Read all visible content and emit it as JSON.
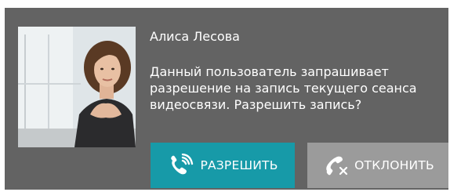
{
  "caller": {
    "name": "Алиса Лесова",
    "photo": "woman-portrait"
  },
  "message": {
    "line1": "Данный пользователь запрашивает",
    "line2": "разрешение на запись текущего сеанса",
    "line3": "видеосвязи. Разрешить запись?"
  },
  "actions": {
    "allow_label": "РАЗРЕШИТЬ",
    "allow_icon": "phone-ringing-icon",
    "allow_color": "#179aa8",
    "decline_label": "ОТКЛОНИТЬ",
    "decline_icon": "phone-hangup-icon",
    "decline_color": "#9b9b9b"
  },
  "colors": {
    "panel_background": "#636363",
    "text": "#ffffff"
  }
}
